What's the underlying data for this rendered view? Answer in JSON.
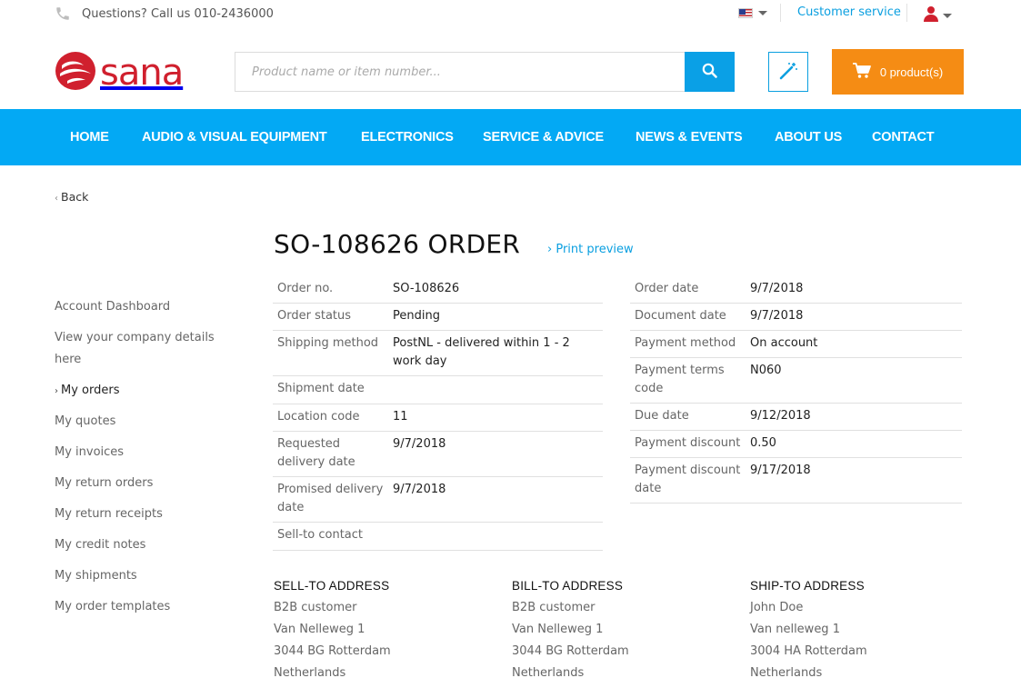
{
  "topbar": {
    "phone_text": "Questions? Call us 010-2436000",
    "customer_service": "Customer service"
  },
  "header": {
    "logo_text": "sana",
    "search_placeholder": "Product name or item number...",
    "cart_label": "0 product(s)"
  },
  "nav": {
    "items": [
      "HOME",
      "AUDIO & VISUAL EQUIPMENT",
      "ELECTRONICS",
      "SERVICE & ADVICE",
      "NEWS & EVENTS",
      "ABOUT US",
      "CONTACT"
    ]
  },
  "back_label": "Back",
  "page": {
    "title": "SO-108626 ORDER",
    "print_preview": "Print preview"
  },
  "sidebar": {
    "items": [
      {
        "label": "Account Dashboard"
      },
      {
        "label": "View your company details here"
      },
      {
        "label": "My orders",
        "active": true
      },
      {
        "label": "My quotes"
      },
      {
        "label": "My invoices"
      },
      {
        "label": "My return orders"
      },
      {
        "label": "My return receipts"
      },
      {
        "label": "My credit notes"
      },
      {
        "label": "My shipments"
      },
      {
        "label": "My order templates"
      }
    ]
  },
  "order_left": [
    {
      "label": "Order no.",
      "value": "SO-108626"
    },
    {
      "label": "Order status",
      "value": "Pending"
    },
    {
      "label": "Shipping method",
      "value": "PostNL - delivered within 1 - 2 work day"
    },
    {
      "label": "Shipment date",
      "value": ""
    },
    {
      "label": "Location code",
      "value": "11"
    },
    {
      "label": "Requested delivery date",
      "value": "9/7/2018"
    },
    {
      "label": "Promised delivery date",
      "value": "9/7/2018"
    },
    {
      "label": "Sell-to contact",
      "value": ""
    }
  ],
  "order_right": [
    {
      "label": "Order date",
      "value": "9/7/2018"
    },
    {
      "label": "Document date",
      "value": "9/7/2018"
    },
    {
      "label": "Payment method",
      "value": "On account"
    },
    {
      "label": "Payment terms code",
      "value": "N060"
    },
    {
      "label": "Due date",
      "value": "9/12/2018"
    },
    {
      "label": "Payment discount",
      "value": "0.50"
    },
    {
      "label": "Payment discount date",
      "value": "9/17/2018"
    }
  ],
  "addresses": {
    "sell_to": {
      "title": "SELL-TO ADDRESS",
      "lines": [
        "B2B customer",
        "Van Nelleweg 1",
        "3044 BG Rotterdam",
        "Netherlands"
      ]
    },
    "bill_to": {
      "title": "BILL-TO ADDRESS",
      "lines": [
        "B2B customer",
        "Van Nelleweg 1",
        "3044 BG Rotterdam",
        "Netherlands"
      ]
    },
    "ship_to": {
      "title": "SHIP-TO ADDRESS",
      "lines": [
        "John Doe",
        "Van nelleweg 1",
        "3004 HA Rotterdam",
        "Netherlands"
      ]
    }
  },
  "colors": {
    "brand_red": "#d0202e",
    "nav_blue": "#03a9f4",
    "cart_orange": "#f58c14",
    "link_blue": "#0a9fe0"
  }
}
